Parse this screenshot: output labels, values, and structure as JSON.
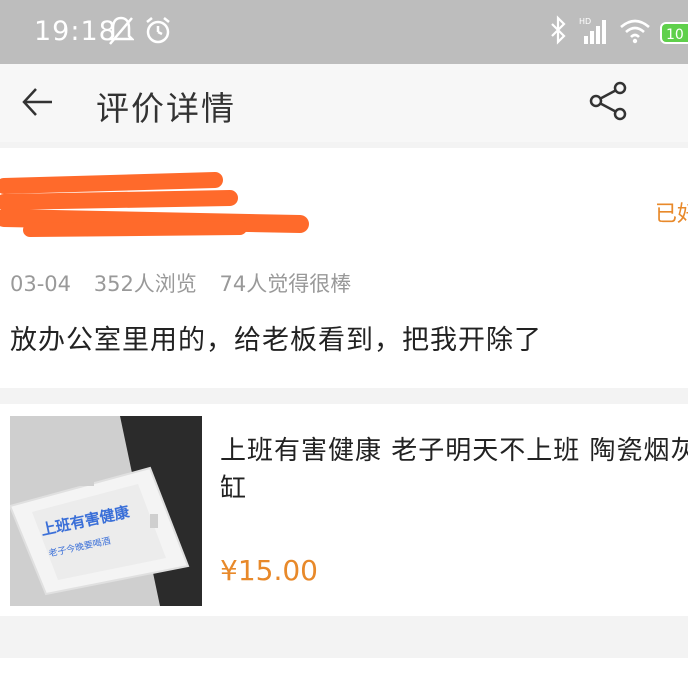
{
  "status_bar": {
    "time": "19:18",
    "battery": "10",
    "icons": [
      "notification-mute-icon",
      "alarm-icon",
      "bluetooth-icon",
      "hd-signal-icon",
      "wifi-icon",
      "battery-icon"
    ]
  },
  "nav": {
    "title": "评价详情",
    "back_icon": "back-arrow-icon",
    "share_icon": "share-icon"
  },
  "review": {
    "status_tag": "已好",
    "date": "03-04",
    "views": "352人浏览",
    "likes": "74人觉得很棒",
    "content": "放办公室里用的，给老板看到，把我开除了",
    "redaction_color": "#ff6a2b"
  },
  "product": {
    "title": "上班有害健康 老子明天不上班 陶瓷烟灰缸",
    "price": "¥15.00",
    "image_text": "上班有害健康",
    "image_subtext": "老子今晚要喝酒"
  },
  "colors": {
    "accent": "#e8892a",
    "status_bar": "#bdbdbd",
    "battery": "#5fd04b"
  }
}
